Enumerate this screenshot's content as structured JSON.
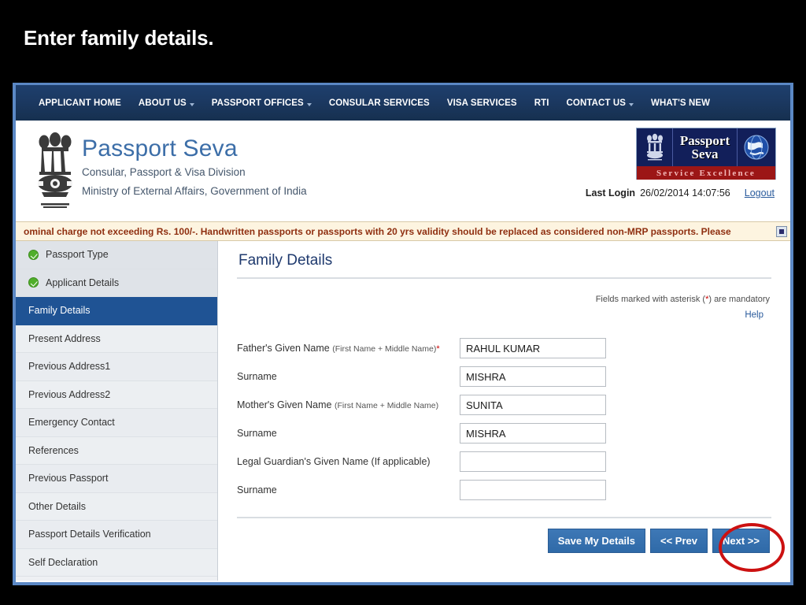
{
  "slide": {
    "title": "Enter family details."
  },
  "nav": {
    "items": [
      {
        "label": "APPLICANT HOME",
        "caret": false
      },
      {
        "label": "ABOUT US",
        "caret": true
      },
      {
        "label": "PASSPORT OFFICES",
        "caret": true
      },
      {
        "label": "CONSULAR SERVICES",
        "caret": false
      },
      {
        "label": "VISA SERVICES",
        "caret": false
      },
      {
        "label": "RTI",
        "caret": false
      },
      {
        "label": "CONTACT US",
        "caret": true
      },
      {
        "label": "WHAT'S NEW",
        "caret": false
      }
    ]
  },
  "header": {
    "brand_title": "Passport Seva",
    "brand_line1": "Consular, Passport & Visa Division",
    "brand_line2": "Ministry of External Affairs, Government of India",
    "logo_line1": "Passport",
    "logo_line2": "Seva",
    "logo_tagline": "Service Excellence",
    "last_login_label": "Last Login",
    "last_login_value": "26/02/2014 14:07:56",
    "logout_label": "Logout"
  },
  "ticker": {
    "text": "ominal charge not exceeding Rs. 100/-. Handwritten passports or passports with 20 yrs validity should be replaced as considered non-MRP passports. Please"
  },
  "sidebar": {
    "items": [
      {
        "label": "Passport Type",
        "state": "done"
      },
      {
        "label": "Applicant Details",
        "state": "done"
      },
      {
        "label": "Family Details",
        "state": "active"
      },
      {
        "label": "Present Address",
        "state": "normal"
      },
      {
        "label": "Previous Address1",
        "state": "normal"
      },
      {
        "label": "Previous Address2",
        "state": "normal"
      },
      {
        "label": "Emergency Contact",
        "state": "normal"
      },
      {
        "label": "References",
        "state": "normal"
      },
      {
        "label": "Previous Passport",
        "state": "normal"
      },
      {
        "label": "Other Details",
        "state": "normal"
      },
      {
        "label": "Passport Details Verification",
        "state": "normal"
      },
      {
        "label": "Self Declaration",
        "state": "normal"
      }
    ]
  },
  "main": {
    "heading": "Family Details",
    "mandatory_note_pre": "Fields marked with asterisk (",
    "mandatory_note_ast": "*",
    "mandatory_note_post": ") are mandatory",
    "help_label": "Help",
    "fields": [
      {
        "label": "Father's Given Name",
        "sub": "(First Name + Middle Name)",
        "required": true,
        "value": "RAHUL KUMAR"
      },
      {
        "label": "Surname",
        "sub": "",
        "required": false,
        "value": "MISHRA"
      },
      {
        "label": "Mother's Given Name",
        "sub": "(First Name + Middle Name)",
        "required": false,
        "value": "SUNITA"
      },
      {
        "label": "Surname",
        "sub": "",
        "required": false,
        "value": "MISHRA"
      },
      {
        "label": "Legal Guardian's Given Name (If applicable)",
        "sub": "",
        "required": false,
        "value": ""
      },
      {
        "label": "Surname",
        "sub": "",
        "required": false,
        "value": ""
      }
    ],
    "buttons": [
      {
        "label": "Save My Details"
      },
      {
        "label": "<< Prev"
      },
      {
        "label": "Next >>"
      }
    ]
  },
  "colors": {
    "nav_bar": "#1b3860",
    "accent_blue": "#3c6ea8",
    "sidebar_active": "#1f5394",
    "button_blue": "#2f6aa8",
    "ticker_bg": "#fdf4e0",
    "ticker_text": "#8f2f10",
    "check_green": "#4fae2a",
    "required_red": "#cc0000",
    "annotation_red": "#cc1111",
    "logo_navy": "#121f5a",
    "logo_red": "#9c1616"
  }
}
